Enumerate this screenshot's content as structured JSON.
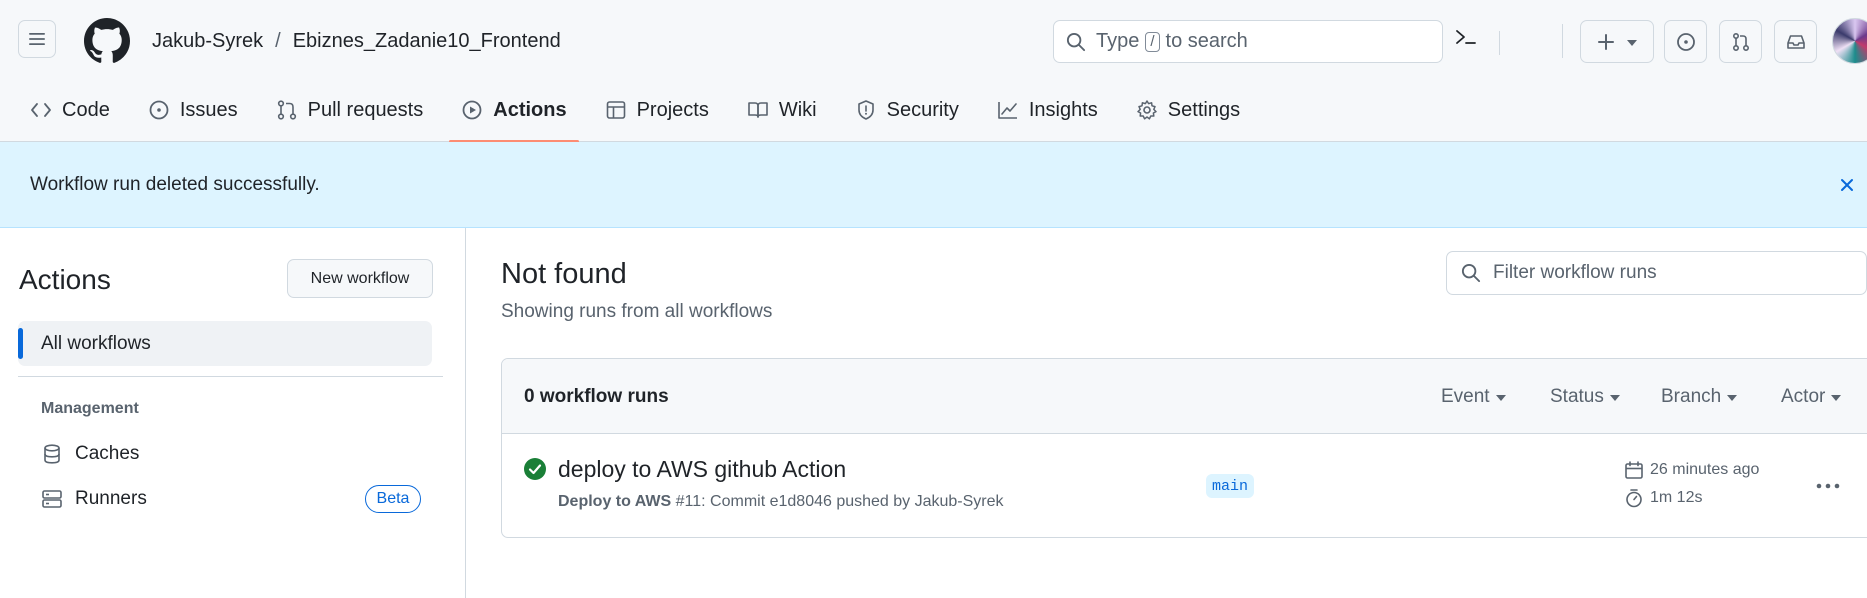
{
  "header": {
    "owner": "Jakub-Syrek",
    "separator": "/",
    "repo": "Ebiznes_Zadanie10_Frontend",
    "search_prefix": "Type",
    "search_key": "/",
    "search_suffix": "to search"
  },
  "tabs": [
    {
      "label": "Code",
      "icon": "code-icon"
    },
    {
      "label": "Issues",
      "icon": "issue-icon"
    },
    {
      "label": "Pull requests",
      "icon": "pull-request-icon"
    },
    {
      "label": "Actions",
      "icon": "play-icon",
      "active": true
    },
    {
      "label": "Projects",
      "icon": "table-icon"
    },
    {
      "label": "Wiki",
      "icon": "book-icon"
    },
    {
      "label": "Security",
      "icon": "shield-icon"
    },
    {
      "label": "Insights",
      "icon": "graph-icon"
    },
    {
      "label": "Settings",
      "icon": "gear-icon"
    }
  ],
  "banner": {
    "message": "Workflow run deleted successfully."
  },
  "sidebar": {
    "title": "Actions",
    "new_workflow": "New workflow",
    "all_workflows": "All workflows",
    "management_heading": "Management",
    "caches": "Caches",
    "runners": "Runners",
    "beta": "Beta"
  },
  "main": {
    "title": "Not found",
    "subtitle": "Showing runs from all workflows",
    "filter_placeholder": "Filter workflow runs",
    "count": "0 workflow runs",
    "filters": [
      "Event",
      "Status",
      "Branch",
      "Actor"
    ]
  },
  "run": {
    "title": "deploy to AWS github Action",
    "workflow": "Deploy to AWS",
    "detail": "#11: Commit e1d8046 pushed by Jakub-Syrek",
    "branch": "main",
    "time_ago": "26 minutes ago",
    "duration": "1m 12s",
    "status": "success"
  },
  "colors": {
    "accent": "#0969da",
    "tab_underline": "#fd8c73",
    "success": "#1a7f37",
    "banner_bg": "#ddf4ff"
  }
}
